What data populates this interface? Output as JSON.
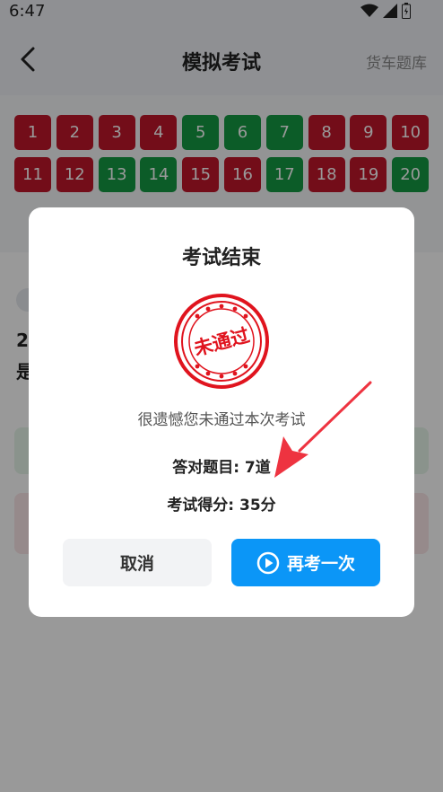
{
  "status_bar": {
    "time": "6:47",
    "tag": "cr4f"
  },
  "header": {
    "title": "模拟考试",
    "right_link": "货车题库"
  },
  "grid": {
    "cells": [
      {
        "n": "1",
        "status": "wrong"
      },
      {
        "n": "2",
        "status": "wrong"
      },
      {
        "n": "3",
        "status": "wrong"
      },
      {
        "n": "4",
        "status": "wrong"
      },
      {
        "n": "5",
        "status": "right"
      },
      {
        "n": "6",
        "status": "right"
      },
      {
        "n": "7",
        "status": "right"
      },
      {
        "n": "8",
        "status": "wrong"
      },
      {
        "n": "9",
        "status": "wrong"
      },
      {
        "n": "10",
        "status": "wrong"
      },
      {
        "n": "11",
        "status": "wrong"
      },
      {
        "n": "12",
        "status": "wrong"
      },
      {
        "n": "13",
        "status": "right"
      },
      {
        "n": "14",
        "status": "right"
      },
      {
        "n": "15",
        "status": "wrong"
      },
      {
        "n": "16",
        "status": "wrong"
      },
      {
        "n": "17",
        "status": "right"
      },
      {
        "n": "18",
        "status": "wrong"
      },
      {
        "n": "19",
        "status": "wrong"
      },
      {
        "n": "20",
        "status": "right"
      }
    ]
  },
  "background": {
    "question_line1": "20",
    "question_line2": "是"
  },
  "dialog": {
    "title": "考试结束",
    "stamp_text": "未通过",
    "message": "很遗憾您未通过本次考试",
    "correct_count": "答对题目: 7道",
    "score": "考试得分: 35分",
    "cancel_label": "取消",
    "retry_label": "再考一次"
  },
  "colors": {
    "wrong": "#c0172b",
    "right": "#149a44",
    "primary": "#0b96f7",
    "stamp": "#e0141e",
    "arrow": "#ee3340"
  }
}
